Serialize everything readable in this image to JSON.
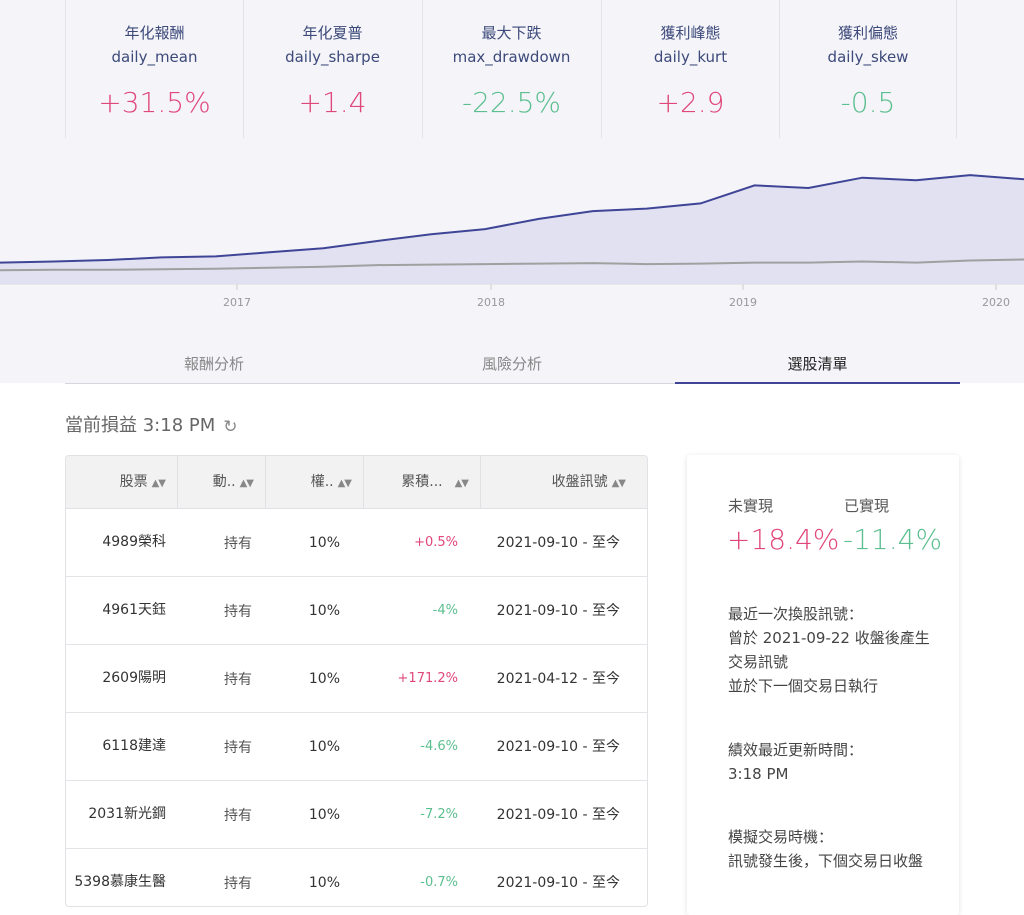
{
  "metrics": [
    {
      "title": "年化報酬",
      "key": "daily_mean",
      "value": "+31.5%",
      "sign": "pos"
    },
    {
      "title": "年化夏普",
      "key": "daily_sharpe",
      "value": "+1.4",
      "sign": "pos"
    },
    {
      "title": "最大下跌",
      "key": "max_drawdown",
      "value": "-22.5%",
      "sign": "neg"
    },
    {
      "title": "獲利峰態",
      "key": "daily_kurt",
      "value": "+2.9",
      "sign": "pos"
    },
    {
      "title": "獲利偏態",
      "key": "daily_skew",
      "value": "-0.5",
      "sign": "neg"
    }
  ],
  "chart_data": {
    "type": "area",
    "x_ticks": [
      "2017",
      "2018",
      "2019",
      "2020"
    ],
    "series": [
      {
        "values": [
          1.0,
          1.02,
          1.05,
          1.1,
          1.12,
          1.2,
          1.28,
          1.42,
          1.55,
          1.65,
          1.85,
          2.0,
          2.05,
          2.15,
          2.5,
          2.45,
          2.65,
          2.6,
          2.7,
          2.62
        ],
        "color": "#3f4596",
        "fill": "#dcdcef"
      },
      {
        "values": [
          0.85,
          0.86,
          0.86,
          0.87,
          0.88,
          0.9,
          0.92,
          0.95,
          0.96,
          0.97,
          0.98,
          0.99,
          0.97,
          0.98,
          1.0,
          1.0,
          1.02,
          1.0,
          1.04,
          1.06
        ],
        "color": "#a0a0a0"
      }
    ]
  },
  "tabs": [
    {
      "label": "報酬分析",
      "active": false
    },
    {
      "label": "風險分析",
      "active": false
    },
    {
      "label": "選股清單",
      "active": true
    }
  ],
  "section": {
    "title": "當前損益 3:18 PM",
    "refresh_icon": "refresh-icon"
  },
  "table": {
    "headers": [
      "股票",
      "動..",
      "權..",
      "累積...",
      "收盤訊號"
    ],
    "rows": [
      {
        "name": "4989榮科",
        "action": "持有",
        "weight": "10%",
        "return": "+0.5%",
        "sign": "pos",
        "signal": "2021-09-10 - 至今"
      },
      {
        "name": "4961天鈺",
        "action": "持有",
        "weight": "10%",
        "return": "-4%",
        "sign": "neg",
        "signal": "2021-09-10 - 至今"
      },
      {
        "name": "2609陽明",
        "action": "持有",
        "weight": "10%",
        "return": "+171.2%",
        "sign": "pos",
        "signal": "2021-04-12 - 至今"
      },
      {
        "name": "6118建達",
        "action": "持有",
        "weight": "10%",
        "return": "-4.6%",
        "sign": "neg",
        "signal": "2021-09-10 - 至今"
      },
      {
        "name": "2031新光鋼",
        "action": "持有",
        "weight": "10%",
        "return": "-7.2%",
        "sign": "neg",
        "signal": "2021-09-10 - 至今"
      },
      {
        "name": "5398慕康生醫",
        "action": "持有",
        "weight": "10%",
        "return": "-0.7%",
        "sign": "neg",
        "signal": "2021-09-10 - 至今"
      }
    ]
  },
  "side": {
    "unrealized_label": "未實現",
    "realized_label": "已實現",
    "unrealized_value": "+18.4%",
    "realized_value": "-11.4%",
    "last_signal": "最近一次換股訊號：\n曾於 2021-09-22 收盤後產生交易訊號\n並於下一個交易日執行",
    "update_time": "績效最近更新時間：\n3:18 PM",
    "sim_timing": "模擬交易時機：\n訊號發生後，下個交易日收盤"
  },
  "colors": {
    "positive": "#e0487a",
    "negative": "#5cbf8f",
    "accent": "#3f4596"
  }
}
